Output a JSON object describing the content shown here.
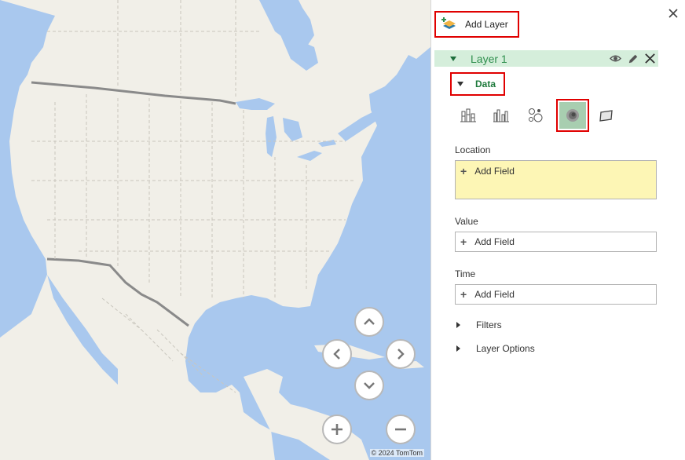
{
  "map": {
    "copyright": "© 2024 TomTom",
    "colors": {
      "water": "#a9c8ee",
      "land": "#f1efe8",
      "border": "#8a8a8a"
    },
    "nav_icons": [
      "chevron-up-icon",
      "chevron-left-icon",
      "chevron-right-icon",
      "chevron-down-icon"
    ],
    "zoom_icons": [
      "plus-icon",
      "minus-icon"
    ]
  },
  "panel": {
    "add_layer_label": "Add Layer",
    "layer": {
      "name": "Layer 1",
      "tools": [
        "eye-icon",
        "pencil-icon",
        "delete-icon"
      ]
    },
    "data_label": "Data",
    "viz_types": [
      "stacked-column-icon",
      "clustered-column-icon",
      "bubble-icon",
      "heat-map-icon",
      "region-icon"
    ],
    "selected_viz": "heat-map-icon",
    "location": {
      "label": "Location",
      "add_field": "Add Field"
    },
    "value": {
      "label": "Value",
      "add_field": "Add Field"
    },
    "time": {
      "label": "Time",
      "add_field": "Add Field"
    },
    "filters_label": "Filters",
    "layer_options_label": "Layer Options",
    "colors": {
      "accent_green": "#2f8f4e",
      "layer_bg": "#d5eedb",
      "highlight_red": "#e00000",
      "location_bg": "#fdf6b5"
    }
  }
}
